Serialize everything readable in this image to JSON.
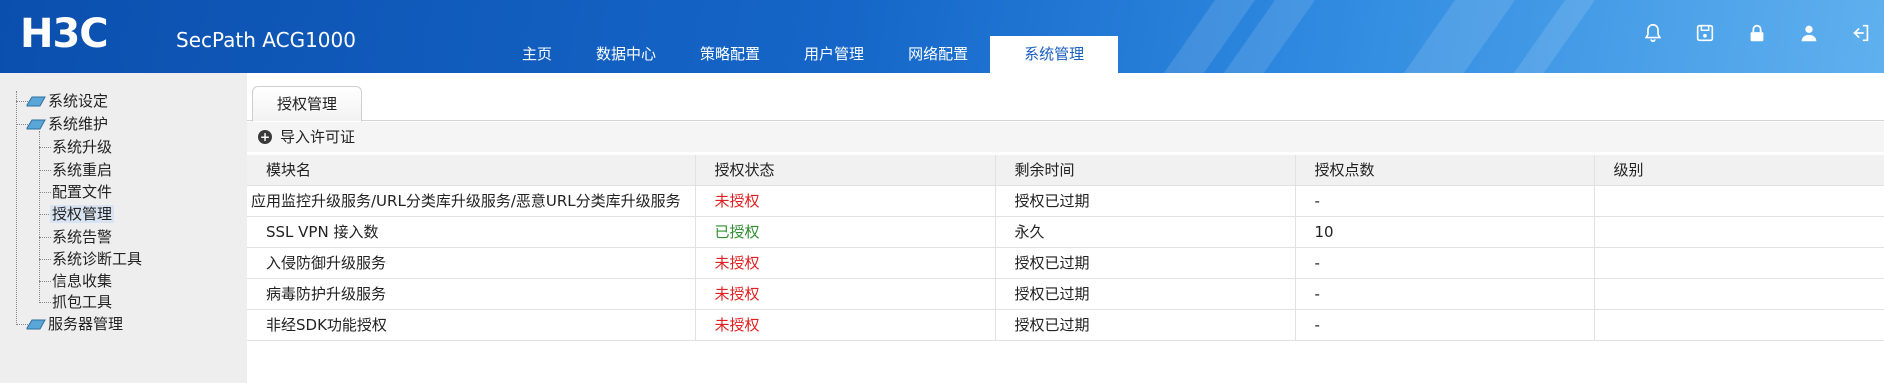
{
  "header": {
    "logo": "H3C",
    "product": "SecPath ACG1000",
    "nav": [
      "主页",
      "数据中心",
      "策略配置",
      "用户管理",
      "网络配置",
      "系统管理"
    ],
    "active_nav_index": 5,
    "icons": [
      "bell-icon",
      "save-icon",
      "lock-icon",
      "user-icon",
      "logout-icon"
    ]
  },
  "sidebar": {
    "items": [
      {
        "label": "系统设定",
        "level": 0,
        "icon": "folder-icon"
      },
      {
        "label": "系统维护",
        "level": 0,
        "icon": "folder-icon"
      },
      {
        "label": "系统升级",
        "level": 1
      },
      {
        "label": "系统重启",
        "level": 1
      },
      {
        "label": "配置文件",
        "level": 1
      },
      {
        "label": "授权管理",
        "level": 1,
        "selected": true
      },
      {
        "label": "系统告警",
        "level": 1
      },
      {
        "label": "系统诊断工具",
        "level": 1
      },
      {
        "label": "信息收集",
        "level": 1
      },
      {
        "label": "抓包工具",
        "level": 1
      },
      {
        "label": "服务器管理",
        "level": 0,
        "icon": "folder-icon"
      }
    ]
  },
  "main": {
    "tab_label": "授权管理",
    "import_label": "导入许可证",
    "table": {
      "columns": [
        "模块名",
        "授权状态",
        "剩余时间",
        "授权点数",
        "级别"
      ],
      "rows": [
        {
          "module": "应用监控升级服务/URL分类库升级服务/恶意URL分类库升级服务",
          "status": "未授权",
          "status_type": "unauthorized",
          "remaining": "授权已过期",
          "points": "-",
          "level": ""
        },
        {
          "module": "SSL VPN 接入数",
          "status": "已授权",
          "status_type": "authorized",
          "remaining": "永久",
          "points": "10",
          "level": ""
        },
        {
          "module": "入侵防御升级服务",
          "status": "未授权",
          "status_type": "unauthorized",
          "remaining": "授权已过期",
          "points": "-",
          "level": ""
        },
        {
          "module": "病毒防护升级服务",
          "status": "未授权",
          "status_type": "unauthorized",
          "remaining": "授权已过期",
          "points": "-",
          "level": ""
        },
        {
          "module": "非经SDK功能授权",
          "status": "未授权",
          "status_type": "unauthorized",
          "remaining": "授权已过期",
          "points": "-",
          "level": ""
        }
      ]
    }
  },
  "colors": {
    "header_blue": "#1566c8",
    "unauthorized": "#e02020",
    "authorized": "#2f8f2f",
    "active_tab_text": "#1a5fbf"
  }
}
